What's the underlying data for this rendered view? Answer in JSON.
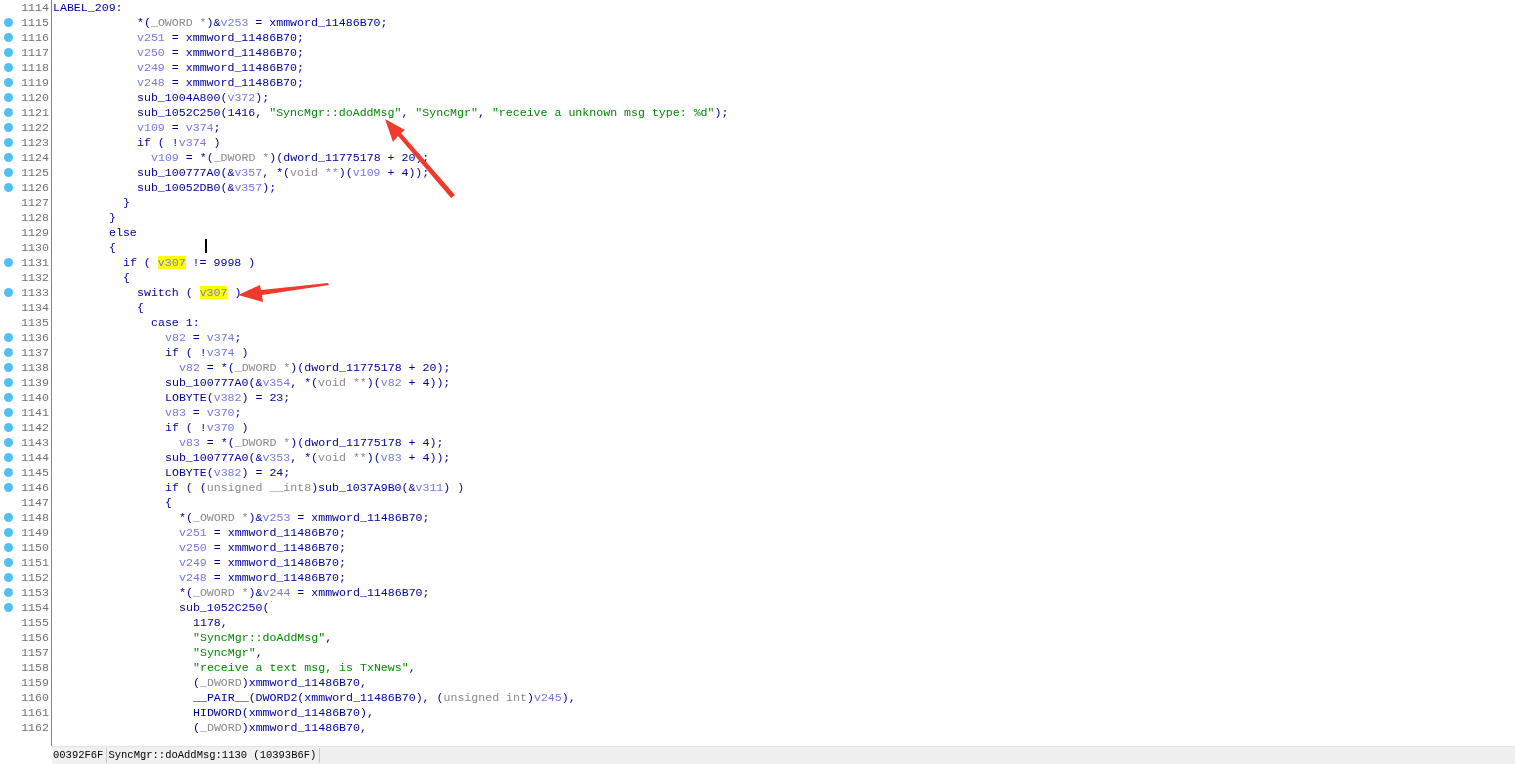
{
  "lines": [
    {
      "number": "1114",
      "breakpoint": false,
      "code": [
        {
          "text": "LABEL_209:",
          "kind": "p"
        }
      ]
    },
    {
      "number": "1115",
      "breakpoint": true,
      "code": [
        {
          "text": "            *(",
          "kind": "p"
        },
        {
          "text": "_OWORD *",
          "kind": "t"
        },
        {
          "text": ")&",
          "kind": "p"
        },
        {
          "text": "v253",
          "kind": "v"
        },
        {
          "text": " = xmmword_11486B70;",
          "kind": "p"
        }
      ]
    },
    {
      "number": "1116",
      "breakpoint": true,
      "code": [
        {
          "text": "            v251",
          "kind": "v"
        },
        {
          "text": " = xmmword_11486B70;",
          "kind": "p"
        }
      ]
    },
    {
      "number": "1117",
      "breakpoint": true,
      "code": [
        {
          "text": "            v250",
          "kind": "v"
        },
        {
          "text": " = xmmword_11486B70;",
          "kind": "p"
        }
      ]
    },
    {
      "number": "1118",
      "breakpoint": true,
      "code": [
        {
          "text": "            v249",
          "kind": "v"
        },
        {
          "text": " = xmmword_11486B70;",
          "kind": "p"
        }
      ]
    },
    {
      "number": "1119",
      "breakpoint": true,
      "code": [
        {
          "text": "            v248",
          "kind": "v"
        },
        {
          "text": " = xmmword_11486B70;",
          "kind": "p"
        }
      ]
    },
    {
      "number": "1120",
      "breakpoint": true,
      "code": [
        {
          "text": "            sub_1004A800(",
          "kind": "p"
        },
        {
          "text": "v372",
          "kind": "v"
        },
        {
          "text": ");",
          "kind": "p"
        }
      ]
    },
    {
      "number": "1121",
      "breakpoint": true,
      "code": [
        {
          "text": "            sub_1052C250(1416, ",
          "kind": "p"
        },
        {
          "text": "\"SyncMgr::doAddMsg\"",
          "kind": "s"
        },
        {
          "text": ", ",
          "kind": "p"
        },
        {
          "text": "\"SyncMgr\"",
          "kind": "s"
        },
        {
          "text": ", ",
          "kind": "p"
        },
        {
          "text": "\"receive a unknown msg type: %d\"",
          "kind": "s"
        },
        {
          "text": ");",
          "kind": "p"
        }
      ]
    },
    {
      "number": "1122",
      "breakpoint": true,
      "code": [
        {
          "text": "            v109",
          "kind": "v"
        },
        {
          "text": " = ",
          "kind": "p"
        },
        {
          "text": "v374",
          "kind": "v"
        },
        {
          "text": ";",
          "kind": "p"
        }
      ]
    },
    {
      "number": "1123",
      "breakpoint": true,
      "code": [
        {
          "text": "            if ( !",
          "kind": "p"
        },
        {
          "text": "v374",
          "kind": "v"
        },
        {
          "text": " )",
          "kind": "p"
        }
      ]
    },
    {
      "number": "1124",
      "breakpoint": true,
      "code": [
        {
          "text": "              v109",
          "kind": "v"
        },
        {
          "text": " = *(",
          "kind": "p"
        },
        {
          "text": "_DWORD *",
          "kind": "t"
        },
        {
          "text": ")(dword_11775178 + 20);",
          "kind": "p"
        }
      ]
    },
    {
      "number": "1125",
      "breakpoint": true,
      "code": [
        {
          "text": "            sub_100777A0(&",
          "kind": "p"
        },
        {
          "text": "v357",
          "kind": "v"
        },
        {
          "text": ", *(",
          "kind": "p"
        },
        {
          "text": "void **",
          "kind": "t"
        },
        {
          "text": ")(",
          "kind": "p"
        },
        {
          "text": "v109",
          "kind": "v"
        },
        {
          "text": " + 4));",
          "kind": "p"
        }
      ]
    },
    {
      "number": "1126",
      "breakpoint": true,
      "code": [
        {
          "text": "            sub_10052DB0(&",
          "kind": "p"
        },
        {
          "text": "v357",
          "kind": "v"
        },
        {
          "text": ");",
          "kind": "p"
        }
      ]
    },
    {
      "number": "1127",
      "breakpoint": false,
      "code": [
        {
          "text": "          }",
          "kind": "p"
        }
      ]
    },
    {
      "number": "1128",
      "breakpoint": false,
      "code": [
        {
          "text": "        }",
          "kind": "p"
        }
      ]
    },
    {
      "number": "1129",
      "breakpoint": false,
      "code": [
        {
          "text": "        else",
          "kind": "p"
        }
      ]
    },
    {
      "number": "1130",
      "breakpoint": false,
      "code": [
        {
          "text": "        {",
          "kind": "p"
        }
      ]
    },
    {
      "number": "1131",
      "breakpoint": true,
      "code": [
        {
          "text": "          if ( ",
          "kind": "p"
        },
        {
          "text": "v307",
          "kind": "h"
        },
        {
          "text": " != 9998 )",
          "kind": "p"
        }
      ]
    },
    {
      "number": "1132",
      "breakpoint": false,
      "code": [
        {
          "text": "          {",
          "kind": "p"
        }
      ]
    },
    {
      "number": "1133",
      "breakpoint": true,
      "code": [
        {
          "text": "            switch ( ",
          "kind": "p"
        },
        {
          "text": "v307",
          "kind": "h"
        },
        {
          "text": " )",
          "kind": "p"
        }
      ]
    },
    {
      "number": "1134",
      "breakpoint": false,
      "code": [
        {
          "text": "            {",
          "kind": "p"
        }
      ]
    },
    {
      "number": "1135",
      "breakpoint": false,
      "code": [
        {
          "text": "              case 1:",
          "kind": "p"
        }
      ]
    },
    {
      "number": "1136",
      "breakpoint": true,
      "code": [
        {
          "text": "                v82",
          "kind": "v"
        },
        {
          "text": " = ",
          "kind": "p"
        },
        {
          "text": "v374",
          "kind": "v"
        },
        {
          "text": ";",
          "kind": "p"
        }
      ]
    },
    {
      "number": "1137",
      "breakpoint": true,
      "code": [
        {
          "text": "                if ( !",
          "kind": "p"
        },
        {
          "text": "v374",
          "kind": "v"
        },
        {
          "text": " )",
          "kind": "p"
        }
      ]
    },
    {
      "number": "1138",
      "breakpoint": true,
      "code": [
        {
          "text": "                  v82",
          "kind": "v"
        },
        {
          "text": " = *(",
          "kind": "p"
        },
        {
          "text": "_DWORD *",
          "kind": "t"
        },
        {
          "text": ")(dword_11775178 + 20);",
          "kind": "p"
        }
      ]
    },
    {
      "number": "1139",
      "breakpoint": true,
      "code": [
        {
          "text": "                sub_100777A0(&",
          "kind": "p"
        },
        {
          "text": "v354",
          "kind": "v"
        },
        {
          "text": ", *(",
          "kind": "p"
        },
        {
          "text": "void **",
          "kind": "t"
        },
        {
          "text": ")(",
          "kind": "p"
        },
        {
          "text": "v82",
          "kind": "v"
        },
        {
          "text": " + 4));",
          "kind": "p"
        }
      ]
    },
    {
      "number": "1140",
      "breakpoint": true,
      "code": [
        {
          "text": "                LOBYTE(",
          "kind": "p"
        },
        {
          "text": "v382",
          "kind": "v"
        },
        {
          "text": ") = 23;",
          "kind": "p"
        }
      ]
    },
    {
      "number": "1141",
      "breakpoint": true,
      "code": [
        {
          "text": "                v83",
          "kind": "v"
        },
        {
          "text": " = ",
          "kind": "p"
        },
        {
          "text": "v370",
          "kind": "v"
        },
        {
          "text": ";",
          "kind": "p"
        }
      ]
    },
    {
      "number": "1142",
      "breakpoint": true,
      "code": [
        {
          "text": "                if ( !",
          "kind": "p"
        },
        {
          "text": "v370",
          "kind": "v"
        },
        {
          "text": " )",
          "kind": "p"
        }
      ]
    },
    {
      "number": "1143",
      "breakpoint": true,
      "code": [
        {
          "text": "                  v83",
          "kind": "v"
        },
        {
          "text": " = *(",
          "kind": "p"
        },
        {
          "text": "_DWORD *",
          "kind": "t"
        },
        {
          "text": ")(dword_11775178 + 4);",
          "kind": "p"
        }
      ]
    },
    {
      "number": "1144",
      "breakpoint": true,
      "code": [
        {
          "text": "                sub_100777A0(&",
          "kind": "p"
        },
        {
          "text": "v353",
          "kind": "v"
        },
        {
          "text": ", *(",
          "kind": "p"
        },
        {
          "text": "void **",
          "kind": "t"
        },
        {
          "text": ")(",
          "kind": "p"
        },
        {
          "text": "v83",
          "kind": "v"
        },
        {
          "text": " + 4));",
          "kind": "p"
        }
      ]
    },
    {
      "number": "1145",
      "breakpoint": true,
      "code": [
        {
          "text": "                LOBYTE(",
          "kind": "p"
        },
        {
          "text": "v382",
          "kind": "v"
        },
        {
          "text": ") = 24;",
          "kind": "p"
        }
      ]
    },
    {
      "number": "1146",
      "breakpoint": true,
      "code": [
        {
          "text": "                if ( (",
          "kind": "p"
        },
        {
          "text": "unsigned __int8",
          "kind": "t"
        },
        {
          "text": ")sub_1037A9B0(&",
          "kind": "p"
        },
        {
          "text": "v311",
          "kind": "v"
        },
        {
          "text": ") )",
          "kind": "p"
        }
      ]
    },
    {
      "number": "1147",
      "breakpoint": false,
      "code": [
        {
          "text": "                {",
          "kind": "p"
        }
      ]
    },
    {
      "number": "1148",
      "breakpoint": true,
      "code": [
        {
          "text": "                  *(",
          "kind": "p"
        },
        {
          "text": "_OWORD *",
          "kind": "t"
        },
        {
          "text": ")&",
          "kind": "p"
        },
        {
          "text": "v253",
          "kind": "v"
        },
        {
          "text": " = xmmword_11486B70;",
          "kind": "p"
        }
      ]
    },
    {
      "number": "1149",
      "breakpoint": true,
      "code": [
        {
          "text": "                  v251",
          "kind": "v"
        },
        {
          "text": " = xmmword_11486B70;",
          "kind": "p"
        }
      ]
    },
    {
      "number": "1150",
      "breakpoint": true,
      "code": [
        {
          "text": "                  v250",
          "kind": "v"
        },
        {
          "text": " = xmmword_11486B70;",
          "kind": "p"
        }
      ]
    },
    {
      "number": "1151",
      "breakpoint": true,
      "code": [
        {
          "text": "                  v249",
          "kind": "v"
        },
        {
          "text": " = xmmword_11486B70;",
          "kind": "p"
        }
      ]
    },
    {
      "number": "1152",
      "breakpoint": true,
      "code": [
        {
          "text": "                  v248",
          "kind": "v"
        },
        {
          "text": " = xmmword_11486B70;",
          "kind": "p"
        }
      ]
    },
    {
      "number": "1153",
      "breakpoint": true,
      "code": [
        {
          "text": "                  *(",
          "kind": "p"
        },
        {
          "text": "_OWORD *",
          "kind": "t"
        },
        {
          "text": ")&",
          "kind": "p"
        },
        {
          "text": "v244",
          "kind": "v"
        },
        {
          "text": " = xmmword_11486B70;",
          "kind": "p"
        }
      ]
    },
    {
      "number": "1154",
      "breakpoint": true,
      "code": [
        {
          "text": "                  sub_1052C250(",
          "kind": "p"
        }
      ]
    },
    {
      "number": "1155",
      "breakpoint": false,
      "code": [
        {
          "text": "                    1178,",
          "kind": "p"
        }
      ]
    },
    {
      "number": "1156",
      "breakpoint": false,
      "code": [
        {
          "text": "                    \"SyncMgr::doAddMsg\"",
          "kind": "s"
        },
        {
          "text": ",",
          "kind": "p"
        }
      ]
    },
    {
      "number": "1157",
      "breakpoint": false,
      "code": [
        {
          "text": "                    \"SyncMgr\"",
          "kind": "s"
        },
        {
          "text": ",",
          "kind": "p"
        }
      ]
    },
    {
      "number": "1158",
      "breakpoint": false,
      "code": [
        {
          "text": "                    \"receive a text msg, is TxNews\"",
          "kind": "s"
        },
        {
          "text": ",",
          "kind": "p"
        }
      ]
    },
    {
      "number": "1159",
      "breakpoint": false,
      "code": [
        {
          "text": "                    (",
          "kind": "p"
        },
        {
          "text": "_DWORD",
          "kind": "t"
        },
        {
          "text": ")xmmword_11486B70,",
          "kind": "p"
        }
      ]
    },
    {
      "number": "1160",
      "breakpoint": false,
      "code": [
        {
          "text": "                    __PAIR__(DWORD2(xmmword_11486B70), (",
          "kind": "p"
        },
        {
          "text": "unsigned int",
          "kind": "t"
        },
        {
          "text": ")",
          "kind": "p"
        },
        {
          "text": "v245",
          "kind": "v"
        },
        {
          "text": "),",
          "kind": "p"
        }
      ]
    },
    {
      "number": "1161",
      "breakpoint": false,
      "code": [
        {
          "text": "                    HIDWORD(xmmword_11486B70),",
          "kind": "p"
        }
      ]
    },
    {
      "number": "1162",
      "breakpoint": false,
      "code": [
        {
          "text": "                    (",
          "kind": "p"
        },
        {
          "text": "_DWORD",
          "kind": "t"
        },
        {
          "text": ")xmmword_11486B70,",
          "kind": "p"
        }
      ]
    }
  ],
  "status_bar": [
    "00392F6F",
    "SyncMgr::doAddMsg:1130 (10393B6F)"
  ]
}
